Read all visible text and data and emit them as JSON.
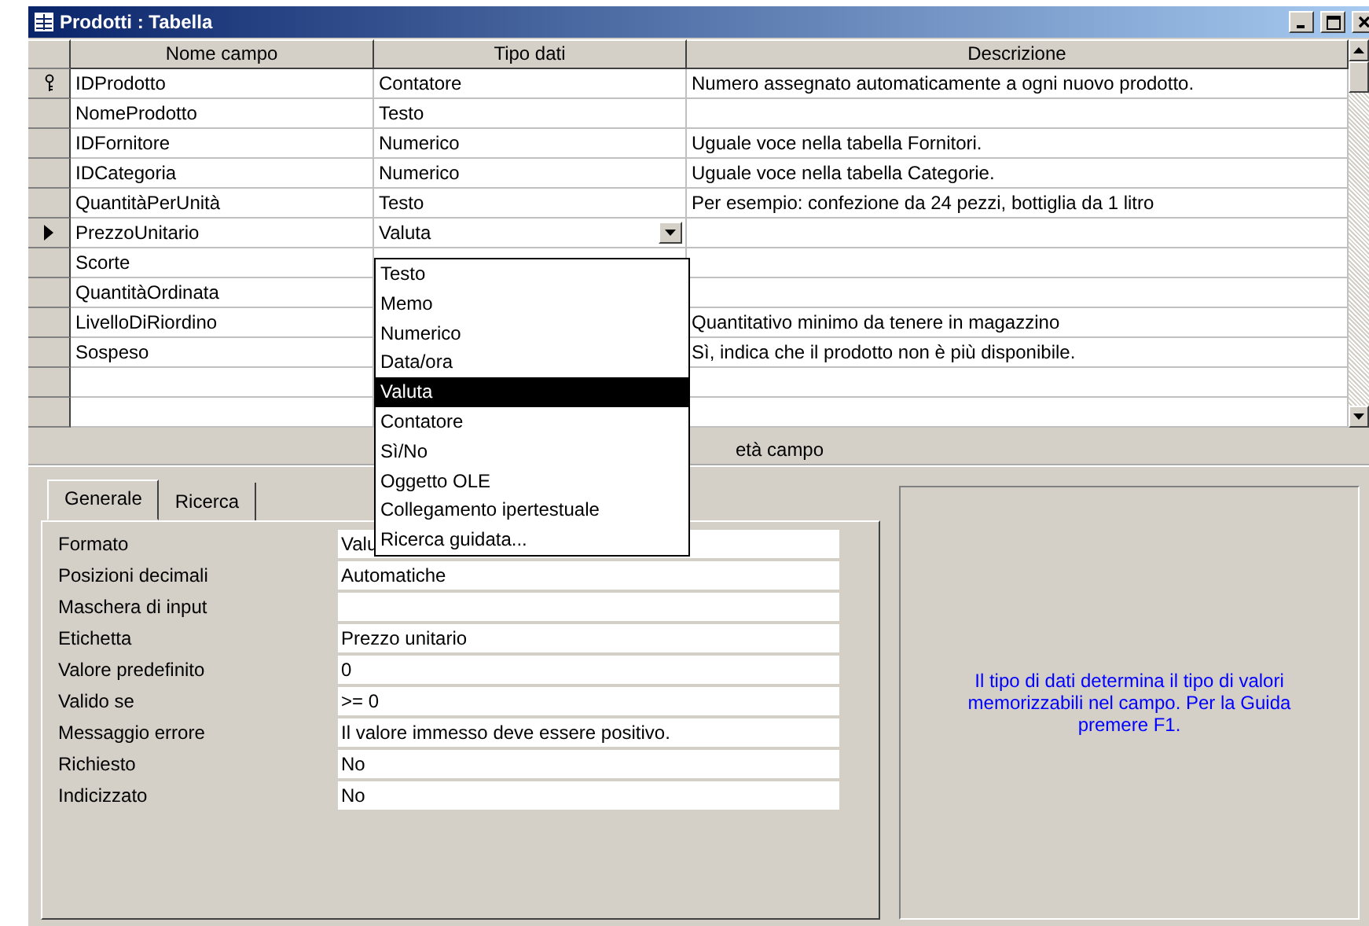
{
  "window": {
    "title": "Prodotti : Tabella"
  },
  "grid": {
    "columns": [
      "Nome campo",
      "Tipo dati",
      "Descrizione"
    ],
    "rows": [
      {
        "name": "IDProdotto",
        "type": "Contatore",
        "description": "Numero assegnato automaticamente a ogni nuovo prodotto.",
        "primary_key": true,
        "selected": false
      },
      {
        "name": "NomeProdotto",
        "type": "Testo",
        "primary_key": false,
        "selected": false
      },
      {
        "name": "IDFornitore",
        "type": "Numerico",
        "description": "Uguale voce nella tabella Fornitori.",
        "primary_key": false,
        "selected": false
      },
      {
        "name": "IDCategoria",
        "type": "Numerico",
        "description": "Uguale voce nella tabella Categorie.",
        "primary_key": false,
        "selected": false
      },
      {
        "name": "QuantitàPerUnità",
        "type": "Testo",
        "description": "Per esempio: confezione da 24 pezzi, bottiglia da 1 litro",
        "primary_key": false,
        "selected": false
      },
      {
        "name": "PrezzoUnitario",
        "type": "Valuta",
        "primary_key": false,
        "selected": true
      },
      {
        "name": "Scorte",
        "primary_key": false,
        "selected": false
      },
      {
        "name": "QuantitàOrdinata",
        "primary_key": false,
        "selected": false
      },
      {
        "name": "LivelloDiRiordino",
        "description": "Quantitativo minimo da tenere in magazzino",
        "primary_key": false,
        "selected": false
      },
      {
        "name": "Sospeso",
        "description": "Sì, indica che il prodotto non è più disponibile.",
        "primary_key": false,
        "selected": false
      }
    ]
  },
  "type_dropdown": {
    "options": [
      {
        "label": "Testo",
        "selected": false
      },
      {
        "label": "Memo",
        "selected": false
      },
      {
        "label": "Numerico",
        "selected": false
      },
      {
        "label": "Data/ora",
        "selected": false
      },
      {
        "label": "Valuta",
        "selected": true
      },
      {
        "label": "Contatore",
        "selected": false
      },
      {
        "label": "Sì/No",
        "selected": false
      },
      {
        "label": "Oggetto OLE",
        "selected": false
      },
      {
        "label": "Collegamento ipertestuale",
        "selected": false
      },
      {
        "label": "Ricerca guidata...",
        "selected": false
      }
    ]
  },
  "section_label": "età campo",
  "properties": {
    "tabs": [
      {
        "label": "Generale",
        "selected": true
      },
      {
        "label": "Ricerca",
        "selected": false
      }
    ],
    "items": [
      {
        "label": "Formato",
        "value": "Valu"
      },
      {
        "label": "Posizioni decimali",
        "value": "Automatiche"
      },
      {
        "label": "Maschera di input"
      },
      {
        "label": "Etichetta",
        "value": "Prezzo unitario"
      },
      {
        "label": "Valore predefinito",
        "value": "0"
      },
      {
        "label": "Valido se",
        "value": ">= 0"
      },
      {
        "label": "Messaggio errore",
        "value": "Il valore immesso deve essere positivo."
      },
      {
        "label": "Richiesto",
        "value": "No"
      },
      {
        "label": "Indicizzato",
        "value": "No"
      }
    ]
  },
  "help_text": "Il tipo di dati determina il tipo di valori memorizzabili nel campo. Per la Guida premere F1."
}
